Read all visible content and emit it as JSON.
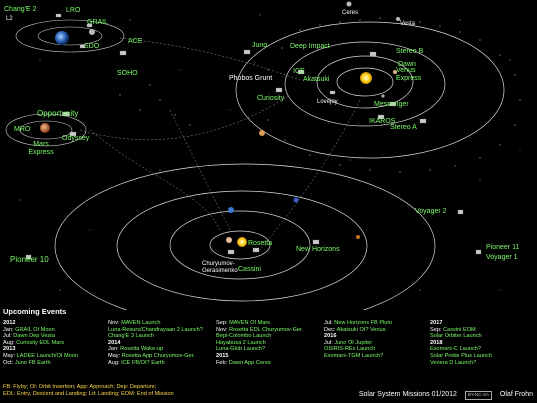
{
  "missions": {
    "changE2": "Chang'E 2",
    "l2": "L2",
    "lro": "LRO",
    "grail": "GRAIL",
    "sdo": "SDO",
    "ace": "ACE",
    "soho": "SOHO",
    "ceres": "Ceres",
    "vesta": "Vesta",
    "juno": "Juno",
    "deepImpact": "Deep Impact",
    "stereoB": "Stereo B",
    "dawn": "Dawn",
    "ice": "ICE",
    "akatsuki": "Akatsuki",
    "venusExpress": "Venus Express",
    "phobosGrunt": "Phobos Grunt",
    "curiosity": "Curiosity",
    "lovejoy": "Lovejoy",
    "messenger": "Messenger",
    "ikaros": "IKAROS",
    "stereoA": "Stereo A",
    "opportunity": "Opportunity",
    "mro": "MRO",
    "odyssey": "Odyssey",
    "marsExpress": "Mars Express",
    "voyager2": "Voyager 2",
    "pioneer10": "Pioneer 10",
    "pioneer11": "Pioneer 11",
    "voyager1": "Voyager 1",
    "rosetta": "Rosetta",
    "churyumov": "Churyumov-Gerasimenko",
    "newHorizons": "New Horizons",
    "cassini": "Cassini"
  },
  "events": {
    "title": "Upcoming Events",
    "columns": [
      [
        {
          "type": "year",
          "text": "2012"
        },
        {
          "pre": "Jan:",
          "text": "GRAIL OI Moon"
        },
        {
          "pre": "Jul:",
          "text": "Dawn Dep Vesta"
        },
        {
          "pre": "Aug:",
          "text": "Curiosity EDL Mars"
        },
        {
          "type": "year",
          "text": "2013"
        },
        {
          "pre": "May:",
          "text": "LADEE Launch/OI Moon"
        },
        {
          "pre": "Oct:",
          "text": "Juno FB Earth"
        }
      ],
      [
        {
          "pre": "Nov:",
          "text": "MAVEN Launch"
        },
        {
          "pre": "",
          "text": "Luna-Resurs/Chandrayaan 2 Launch?"
        },
        {
          "pre": "",
          "text": "Chang'E 3 Launch"
        },
        {
          "type": "year",
          "text": "2014"
        },
        {
          "pre": "Jan:",
          "text": "Rosetta Wake-up"
        },
        {
          "pre": "May:",
          "text": "Rosetta App Churyumov-Ger."
        },
        {
          "pre": "Aug:",
          "text": "ICE FB/OI? Earth"
        }
      ],
      [
        {
          "pre": "Sep:",
          "text": "MAVEN OI Mars"
        },
        {
          "pre": "Nov:",
          "text": "Rosetta EDL Churyumov-Ger."
        },
        {
          "pre": "",
          "text": "Bepi-Colombo Launch"
        },
        {
          "pre": "",
          "text": "Hayabusa 2 Launch"
        },
        {
          "pre": "",
          "text": "Luna-Glob Launch?"
        },
        {
          "type": "year",
          "text": "2015"
        },
        {
          "pre": "Feb:",
          "text": "Dawn App Ceres"
        }
      ],
      [
        {
          "pre": "Jul:",
          "text": "New Horizons FB Pluto"
        },
        {
          "pre": "Dec:",
          "text": "Akatsuki OI? Venus"
        },
        {
          "type": "year",
          "text": "2016"
        },
        {
          "pre": "Jul:",
          "text": "Juno OI Jupiter"
        },
        {
          "pre": "",
          "text": "OSIRIS-REx Launch"
        },
        {
          "pre": "",
          "text": "Exomars-TGM Launch?"
        }
      ],
      [
        {
          "type": "year",
          "text": "2017"
        },
        {
          "pre": "Sep:",
          "text": "Cassini EOM"
        },
        {
          "pre": "",
          "text": "Solar Orbiter Launch"
        },
        {
          "type": "year",
          "text": "2018"
        },
        {
          "pre": "",
          "text": "Exomars-C Launch?"
        },
        {
          "pre": "",
          "text": "Solar Probe Plus Launch"
        },
        {
          "pre": "",
          "text": "Venera D Launch?"
        }
      ]
    ],
    "legend_line1": "FB: Flyby; OI: Orbit Insertion; App: Approach; Dep: Departure;",
    "legend_line2": "EDL: Entry, Descent and Landing; Ld: Landing; EOM: End of Mission"
  },
  "footer": {
    "title": "Solar System Missions 01/2012",
    "license": "BY-NC-SA",
    "author": "Olaf Frohn"
  }
}
